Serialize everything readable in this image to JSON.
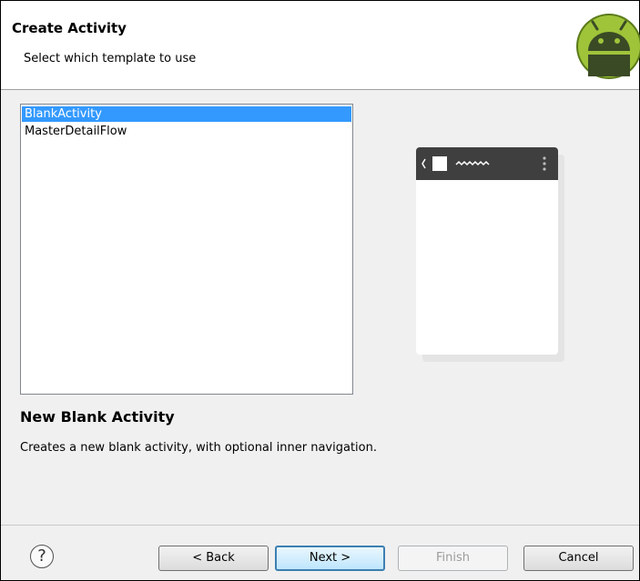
{
  "header": {
    "title": "Create Activity",
    "subtitle": "Select which template to use",
    "logo_icon": "android-logo-icon"
  },
  "templates": {
    "items": [
      "BlankActivity",
      "MasterDetailFlow"
    ],
    "selected": "BlankActivity"
  },
  "preview": {
    "icons": [
      "back-chevron-icon",
      "app-icon",
      "title-squiggle-icon",
      "overflow-menu-icon"
    ]
  },
  "description": {
    "title": "New Blank Activity",
    "text": "Creates a new blank activity, with optional inner navigation."
  },
  "footer": {
    "help_icon": "help-icon",
    "help_glyph": "?",
    "back_label": "< Back",
    "next_label": "Next >",
    "finish_label": "Finish",
    "cancel_label": "Cancel"
  },
  "colors": {
    "selection": "#3399ff",
    "android_green": "#9fc43a",
    "phone_bar": "#3f3f3f"
  }
}
